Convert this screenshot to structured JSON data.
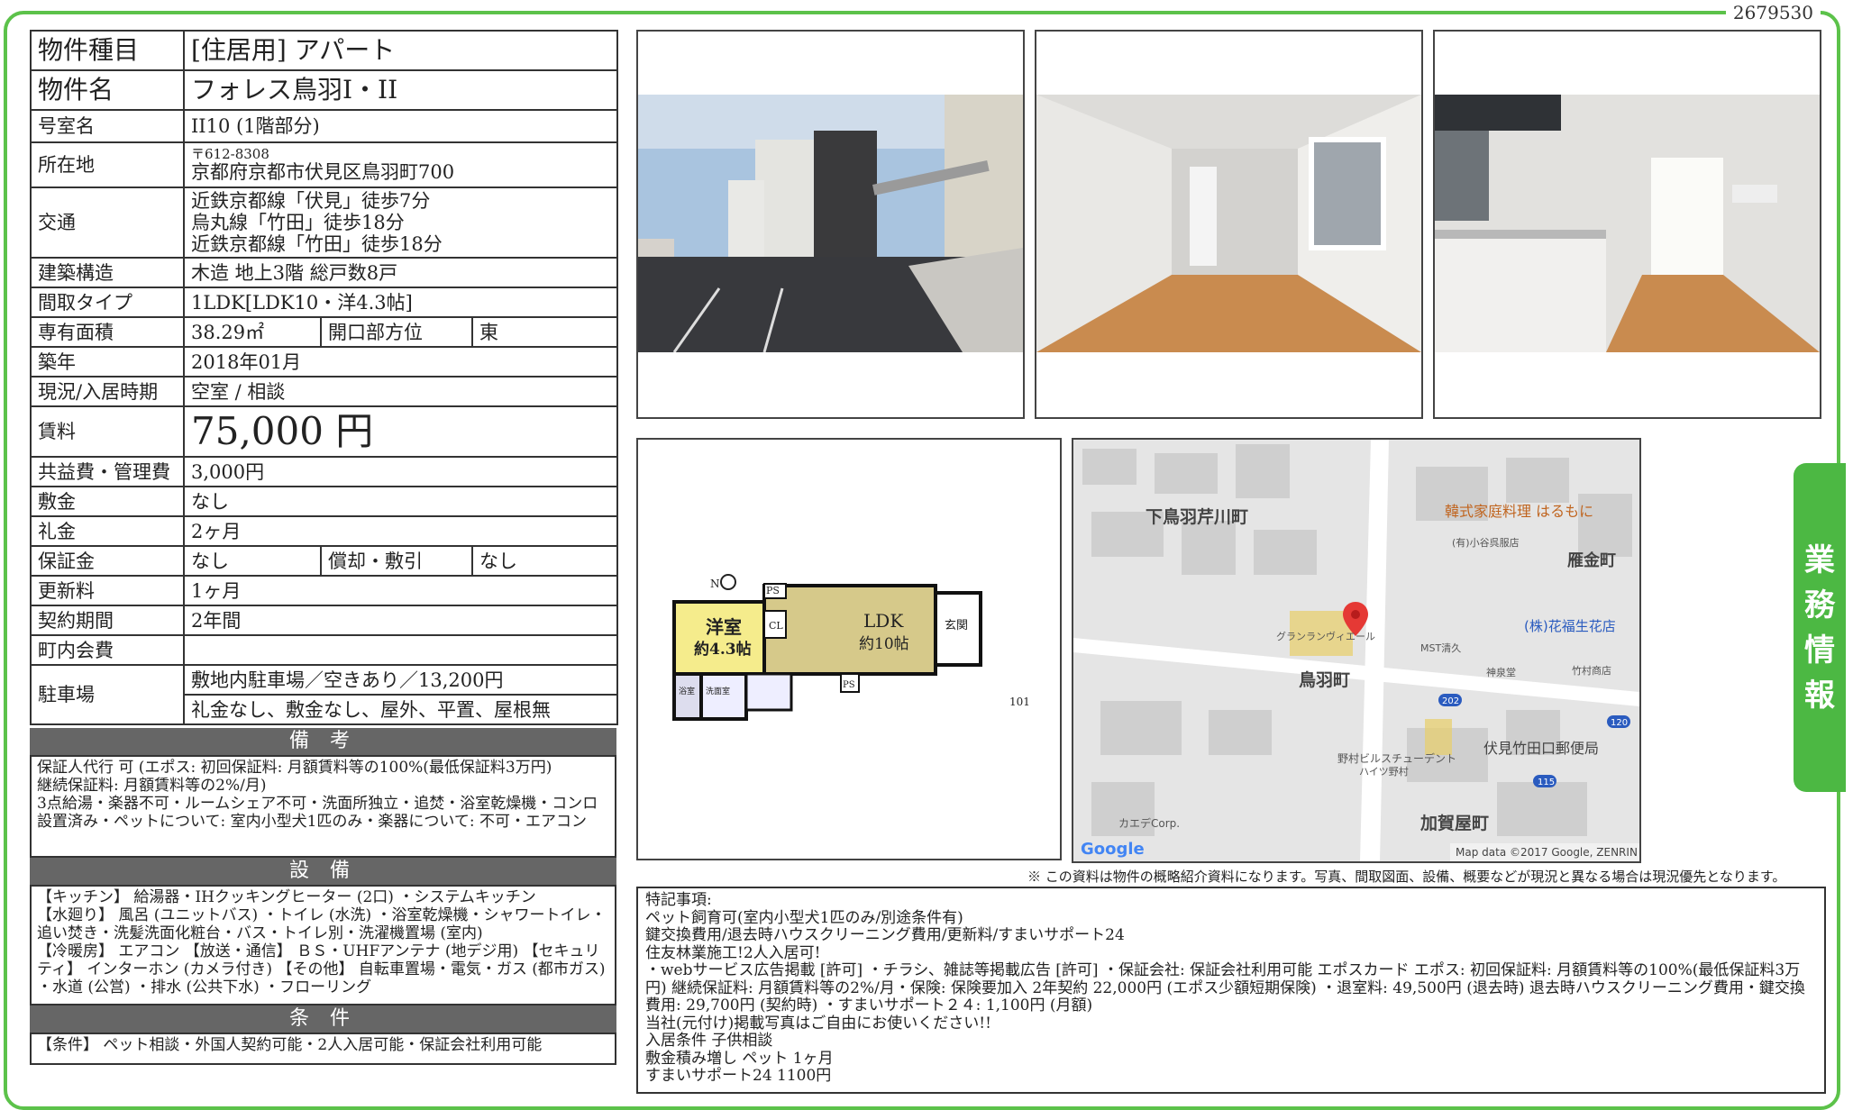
{
  "doc_id": "2679530",
  "side_tab": [
    "業",
    "務",
    "情",
    "報"
  ],
  "property": {
    "type_label": "物件種目",
    "type_value": "[住居用] アパート",
    "name_label": "物件名",
    "name_value": "フォレス鳥羽I・II",
    "room_label": "号室名",
    "room_value": "II10 (1階部分)",
    "address_label": "所在地",
    "postal": "〒612-8308",
    "address": "京都府京都市伏見区鳥羽町700",
    "access_label": "交通",
    "access": [
      "近鉄京都線「伏見」徒歩7分",
      "烏丸線「竹田」徒歩18分",
      "近鉄京都線「竹田」徒歩18分"
    ],
    "structure_label": "建築構造",
    "structure_value": "木造 地上3階 総戸数8戸",
    "layout_label": "間取タイプ",
    "layout_value": "1LDK[LDK10・洋4.3帖]",
    "area_label": "専有面積",
    "area_value": "38.29㎡",
    "direction_label": "開口部方位",
    "direction_value": "東",
    "built_label": "築年",
    "built_value": "2018年01月",
    "status_label": "現況/入居時期",
    "status_value": "空室 / 相談",
    "rent_label": "賃料",
    "rent_value": "75,000 円",
    "fee_label": "共益費・管理費",
    "fee_value": "3,000円",
    "deposit_label": "敷金",
    "deposit_value": "なし",
    "keymoney_label": "礼金",
    "keymoney_value": "2ヶ月",
    "guarantee_label": "保証金",
    "guarantee_value": "なし",
    "amort_label": "償却・敷引",
    "amort_value": "なし",
    "renewal_label": "更新料",
    "renewal_value": "1ヶ月",
    "contract_label": "契約期間",
    "contract_value": "2年間",
    "assoc_label": "町内会費",
    "assoc_value": "",
    "parking_label": "駐車場",
    "parking_value1": "敷地内駐車場／空きあり／13,200円",
    "parking_value2": "礼金なし、敷金なし、屋外、平置、屋根無"
  },
  "notes": {
    "title": "備 考",
    "text": "保証人代行 可 (エポス: 初回保証料: 月額賃料等の100%(最低保証料3万円)\n継続保証料: 月額賃料等の2%/月)\n3点給湯・楽器不可・ルームシェア不可・洗面所独立・追焚・浴室乾燥機・コンロ設置済み・ペットについて: 室内小型犬1匹のみ・楽器について: 不可・エアコン"
  },
  "equipment": {
    "title": "設 備",
    "text": "【キッチン】 給湯器・IHクッキングヒーター (2口) ・システムキッチン\n【水廻り】 風呂 (ユニットバス) ・トイレ (水洗) ・浴室乾燥機・シャワートイレ・追い焚き・洗髪洗面化粧台・バス・トイレ別・洗濯機置場 (室内)\n【冷暖房】 エアコン 【放送・通信】 ＢＳ・UHFアンテナ (地デジ用) 【セキュリティ】 インターホン (カメラ付き) 【その他】 自転車置場・電気・ガス (都市ガス) ・水道 (公営) ・排水 (公共下水) ・フローリング"
  },
  "conditions": {
    "title": "条 件",
    "text": "【条件】 ペット相談・外国人契約可能・2人入居可能・保証会社利用可能"
  },
  "floorplan": {
    "room1_name": "洋室",
    "room1_size": "約4.3帖",
    "room2_name": "LDK",
    "room2_size": "約10帖",
    "entrance": "玄関",
    "unit": "101",
    "tags": [
      "PS",
      "CL",
      "PS",
      "浴室",
      "洗面室"
    ]
  },
  "map": {
    "labels": [
      "下鳥羽芹川町",
      "韓式家庭料理 はるもに",
      "(有)小谷呉服店",
      "雁金町",
      "(株)花福生花店",
      "グランランヴィエール",
      "MST清久",
      "神泉堂",
      "竹村商店",
      "鳥羽町",
      "野村ビルスチューデント",
      "ハイツ野村",
      "伏見竹田口郵便局",
      "カエデCorp.",
      "加賀屋町"
    ],
    "roads": [
      "202",
      "120",
      "115"
    ],
    "attribution": "Map data ©2017 Google, ZENRIN",
    "logo": "Google"
  },
  "disclaimer": "※ この資料は物件の概略紹介資料になります。写真、間取図面、設備、概要などが現況と異なる場合は現況優先となります。",
  "remarks": "特記事項:\nペット飼育可(室内小型犬1匹のみ/別途条件有)\n鍵交換費用/退去時ハウスクリーニング費用/更新料/すまいサポート24\n住友林業施工!2人入居可!\n・webサービス広告掲載 [許可] ・チラシ、雑誌等掲載広告 [許可] ・保証会社: 保証会社利用可能 エポスカード エポス: 初回保証料: 月額賃料等の100%(最低保証料3万円) 継続保証料: 月額賃料等の2%/月・保険: 保険要加入 2年契約 22,000円 (エポス少額短期保険) ・退室料: 49,500円 (退去時) 退去時ハウスクリーニング費用・鍵交換費用: 29,700円 (契約時) ・すまいサポート２４: 1,100円 (月額)\n当社(元付け)掲載写真はご自由にお使いください!!\n入居条件 子供相談\n敷金積み増し ペット 1ヶ月\nすまいサポート24 1100円",
  "colors": {
    "frame": "#5cc24a",
    "tab": "#4cb843",
    "section_head": "#666666"
  }
}
